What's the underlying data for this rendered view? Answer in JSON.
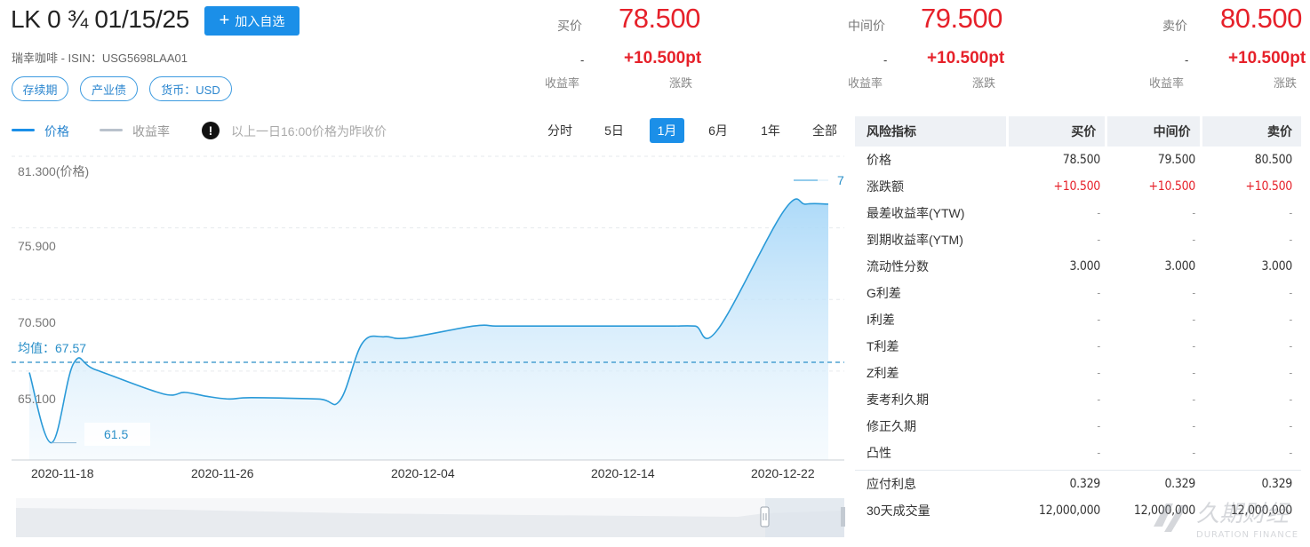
{
  "header": {
    "title": "LK 0 ¾ 01/15/25",
    "add_button": "加入自选",
    "issuer_isin": "瑞幸咖啡 - ISIN：USG5698LAA01",
    "tags": [
      "存续期",
      "产业债",
      "货币：USD"
    ]
  },
  "quotes": [
    {
      "label": "买价",
      "value": "78.500",
      "dash": "-",
      "change": "+10.500pt",
      "sub_left": "收益率",
      "sub_right": "涨跌"
    },
    {
      "label": "中间价",
      "value": "79.500",
      "dash": "-",
      "change": "+10.500pt",
      "sub_left": "收益率",
      "sub_right": "涨跌"
    },
    {
      "label": "卖价",
      "value": "80.500",
      "dash": "-",
      "change": "+10.500pt",
      "sub_left": "收益率",
      "sub_right": "涨跌"
    }
  ],
  "chart_controls": {
    "legend_price": "价格",
    "legend_yield": "收益率",
    "notice": "以上一日16:00价格为昨收价",
    "ranges": [
      "分时",
      "5日",
      "1月",
      "6月",
      "1年",
      "全部"
    ],
    "active_range": "1月"
  },
  "chart_data": {
    "type": "area",
    "ylabel": "81.300(价格)",
    "y_ticks": [
      "81.300(价格)",
      "75.900",
      "70.500",
      "65.100"
    ],
    "y_tick_values": [
      81.3,
      75.9,
      70.5,
      65.1
    ],
    "ylim": [
      60.2,
      81.3
    ],
    "x_ticks": [
      "2020-11-18",
      "2020-11-26",
      "2020-12-04",
      "2020-12-14",
      "2020-12-22"
    ],
    "average_label": "均值：",
    "average_value": "67.57",
    "average": 67.57,
    "min_label": "61.5",
    "max_label": "7",
    "series": [
      {
        "x": [
          "2020-11-17",
          "2020-11-18",
          "2020-11-19",
          "2020-11-20",
          "2020-11-23",
          "2020-11-24",
          "2020-11-25",
          "2020-11-26",
          "2020-11-27",
          "2020-11-30",
          "2020-12-01",
          "2020-12-02",
          "2020-12-03",
          "2020-12-04",
          "2020-12-07",
          "2020-12-08",
          "2020-12-09",
          "2020-12-10",
          "2020-12-11",
          "2020-12-14",
          "2020-12-15",
          "2020-12-16",
          "2020-12-17",
          "2020-12-18",
          "2020-12-21",
          "2020-12-22",
          "2020-12-23"
        ],
        "values": [
          66.8,
          61.5,
          67.5,
          67.0,
          65.2,
          65.3,
          65.0,
          64.8,
          64.9,
          64.8,
          64.7,
          69.0,
          69.5,
          69.4,
          70.3,
          70.3,
          70.3,
          70.3,
          70.3,
          70.3,
          70.3,
          70.3,
          70.3,
          70.0,
          79.0,
          79.5,
          79.5
        ]
      }
    ],
    "grid": true
  },
  "risk_table": {
    "headers": [
      "风险指标",
      "买价",
      "中间价",
      "卖价"
    ],
    "rows": [
      {
        "label": "价格",
        "v": [
          "78.500",
          "79.500",
          "80.500"
        ],
        "red": false
      },
      {
        "label": "涨跌额",
        "v": [
          "+10.500",
          "+10.500",
          "+10.500"
        ],
        "red": true
      },
      {
        "label": "最差收益率(YTW)",
        "v": [
          "-",
          "-",
          "-"
        ],
        "red": false
      },
      {
        "label": "到期收益率(YTM)",
        "v": [
          "-",
          "-",
          "-"
        ],
        "red": false
      },
      {
        "label": "流动性分数",
        "v": [
          "3.000",
          "3.000",
          "3.000"
        ],
        "red": false
      },
      {
        "label": "G利差",
        "v": [
          "-",
          "-",
          "-"
        ],
        "red": false
      },
      {
        "label": "I利差",
        "v": [
          "-",
          "-",
          "-"
        ],
        "red": false
      },
      {
        "label": "T利差",
        "v": [
          "-",
          "-",
          "-"
        ],
        "red": false
      },
      {
        "label": "Z利差",
        "v": [
          "-",
          "-",
          "-"
        ],
        "red": false
      },
      {
        "label": "麦考利久期",
        "v": [
          "-",
          "-",
          "-"
        ],
        "red": false
      },
      {
        "label": "修正久期",
        "v": [
          "-",
          "-",
          "-"
        ],
        "red": false
      },
      {
        "label": "凸性",
        "v": [
          "-",
          "-",
          "-"
        ],
        "red": false
      }
    ],
    "extra_rows": [
      {
        "label": "应付利息",
        "v": [
          "0.329",
          "0.329",
          "0.329"
        ]
      },
      {
        "label": "30天成交量",
        "v": [
          "12,000,000",
          "12,000,000",
          "12,000,000"
        ]
      }
    ]
  },
  "watermark": {
    "cn": "久期财经",
    "en": "DURATION FINANCE"
  },
  "colors": {
    "accent": "#1b8fe8",
    "up": "#e6212a",
    "line": "#2a9ad8",
    "fill_top": "#a9d8f8",
    "fill_bottom": "#eef7fd"
  }
}
